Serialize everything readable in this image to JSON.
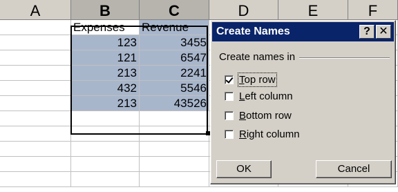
{
  "spreadsheet": {
    "columns": [
      "A",
      "B",
      "C",
      "D",
      "E",
      "F"
    ],
    "rows": [
      {
        "a": "",
        "b": "Expenses",
        "c": "Revenue"
      },
      {
        "a": "",
        "b": "123",
        "c": "3455"
      },
      {
        "a": "",
        "b": "121",
        "c": "6547"
      },
      {
        "a": "",
        "b": "213",
        "c": "2241"
      },
      {
        "a": "",
        "b": "432",
        "c": "5546"
      },
      {
        "a": "",
        "b": "213",
        "c": "43526"
      },
      {
        "a": "",
        "b": "",
        "c": ""
      },
      {
        "a": "",
        "b": "",
        "c": ""
      },
      {
        "a": "",
        "b": "",
        "c": ""
      },
      {
        "a": "",
        "b": "",
        "c": ""
      },
      {
        "a": "",
        "b": "",
        "c": ""
      }
    ],
    "selection_color": "#a8b6cc"
  },
  "dialog": {
    "title": "Create Names",
    "help_button": "?",
    "close_button": "✕",
    "group_label": "Create names in",
    "options": [
      {
        "label_prefix": "",
        "label_hotkey": "T",
        "label_rest": "op row",
        "checked": true
      },
      {
        "label_prefix": "",
        "label_hotkey": "L",
        "label_rest": "eft column",
        "checked": false
      },
      {
        "label_prefix": "",
        "label_hotkey": "B",
        "label_rest": "ottom row",
        "checked": false
      },
      {
        "label_prefix": "",
        "label_hotkey": "R",
        "label_rest": "ight column",
        "checked": false
      }
    ],
    "ok_label": "OK",
    "cancel_label": "Cancel",
    "title_bar_color": "#0a246a"
  }
}
